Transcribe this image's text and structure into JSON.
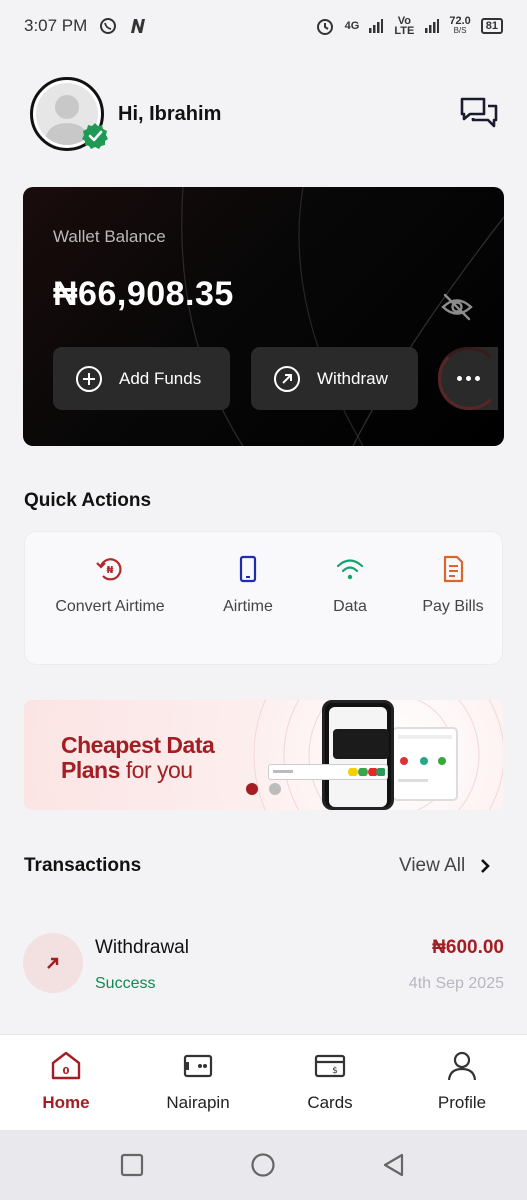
{
  "status_bar": {
    "time": "3:07 PM",
    "network": "4G",
    "volte": "Vo LTE",
    "speed": "72.0",
    "speed_unit": "B/S",
    "battery": "81"
  },
  "header": {
    "greeting": "Hi, Ibrahim"
  },
  "wallet": {
    "label": "Wallet Balance",
    "amount": "₦66,908.35",
    "add_funds_label": "Add Funds",
    "withdraw_label": "Withdraw"
  },
  "quick_actions": {
    "title": "Quick Actions",
    "items": [
      {
        "label": "Convert Airtime",
        "icon": "convert-airtime-icon",
        "color": "#b3282d"
      },
      {
        "label": "Airtime",
        "icon": "phone-icon",
        "color": "#1f2bb0"
      },
      {
        "label": "Data",
        "icon": "wifi-icon",
        "color": "#12a36b"
      },
      {
        "label": "Pay Bills",
        "icon": "document-icon",
        "color": "#d9662a"
      }
    ]
  },
  "banner": {
    "line1": "Cheapest Data",
    "line2_bold": "Plans",
    "line2_rest": " for you",
    "slides_total": 2,
    "active_slide": 1
  },
  "transactions": {
    "title": "Transactions",
    "view_all": "View All",
    "items": [
      {
        "name": "Withdrawal",
        "status": "Success",
        "amount": "₦600.00",
        "date": "4th Sep 2025"
      }
    ]
  },
  "bottom_nav": {
    "items": [
      {
        "label": "Home",
        "icon": "home-icon",
        "active": true
      },
      {
        "label": "Nairapin",
        "icon": "nairapin-icon",
        "active": false
      },
      {
        "label": "Cards",
        "icon": "cards-icon",
        "active": false
      },
      {
        "label": "Profile",
        "icon": "profile-icon",
        "active": false
      }
    ]
  },
  "colors": {
    "brand": "#a31e23",
    "success": "#0f8a50",
    "card_bg": "#000000"
  }
}
